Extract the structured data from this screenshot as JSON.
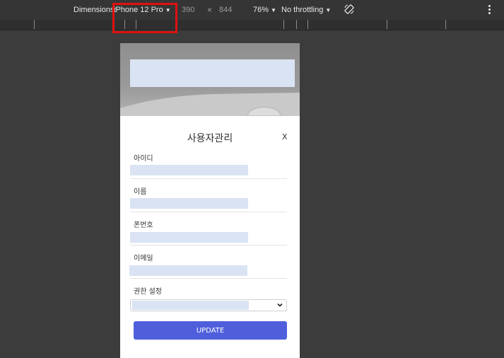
{
  "devtools": {
    "dimensions_label": "Dimensions:",
    "device": "iPhone 12 Pro",
    "width": "390",
    "times": "×",
    "height": "844",
    "zoom": "76%",
    "throttling": "No throttling"
  },
  "modal": {
    "title": "사용자관리",
    "close_label": "X",
    "fields": [
      {
        "label": "아이디",
        "value": ""
      },
      {
        "label": "이름",
        "value": ""
      },
      {
        "label": "폰번호",
        "value": ""
      },
      {
        "label": "이메일",
        "value": ""
      }
    ],
    "permission": {
      "label": "권한 설정",
      "value": ""
    },
    "update_label": "UPDATE"
  },
  "colors": {
    "accent": "#4f5fdc",
    "placeholder_fill": "#dae3f3",
    "highlight": "#e01010"
  }
}
